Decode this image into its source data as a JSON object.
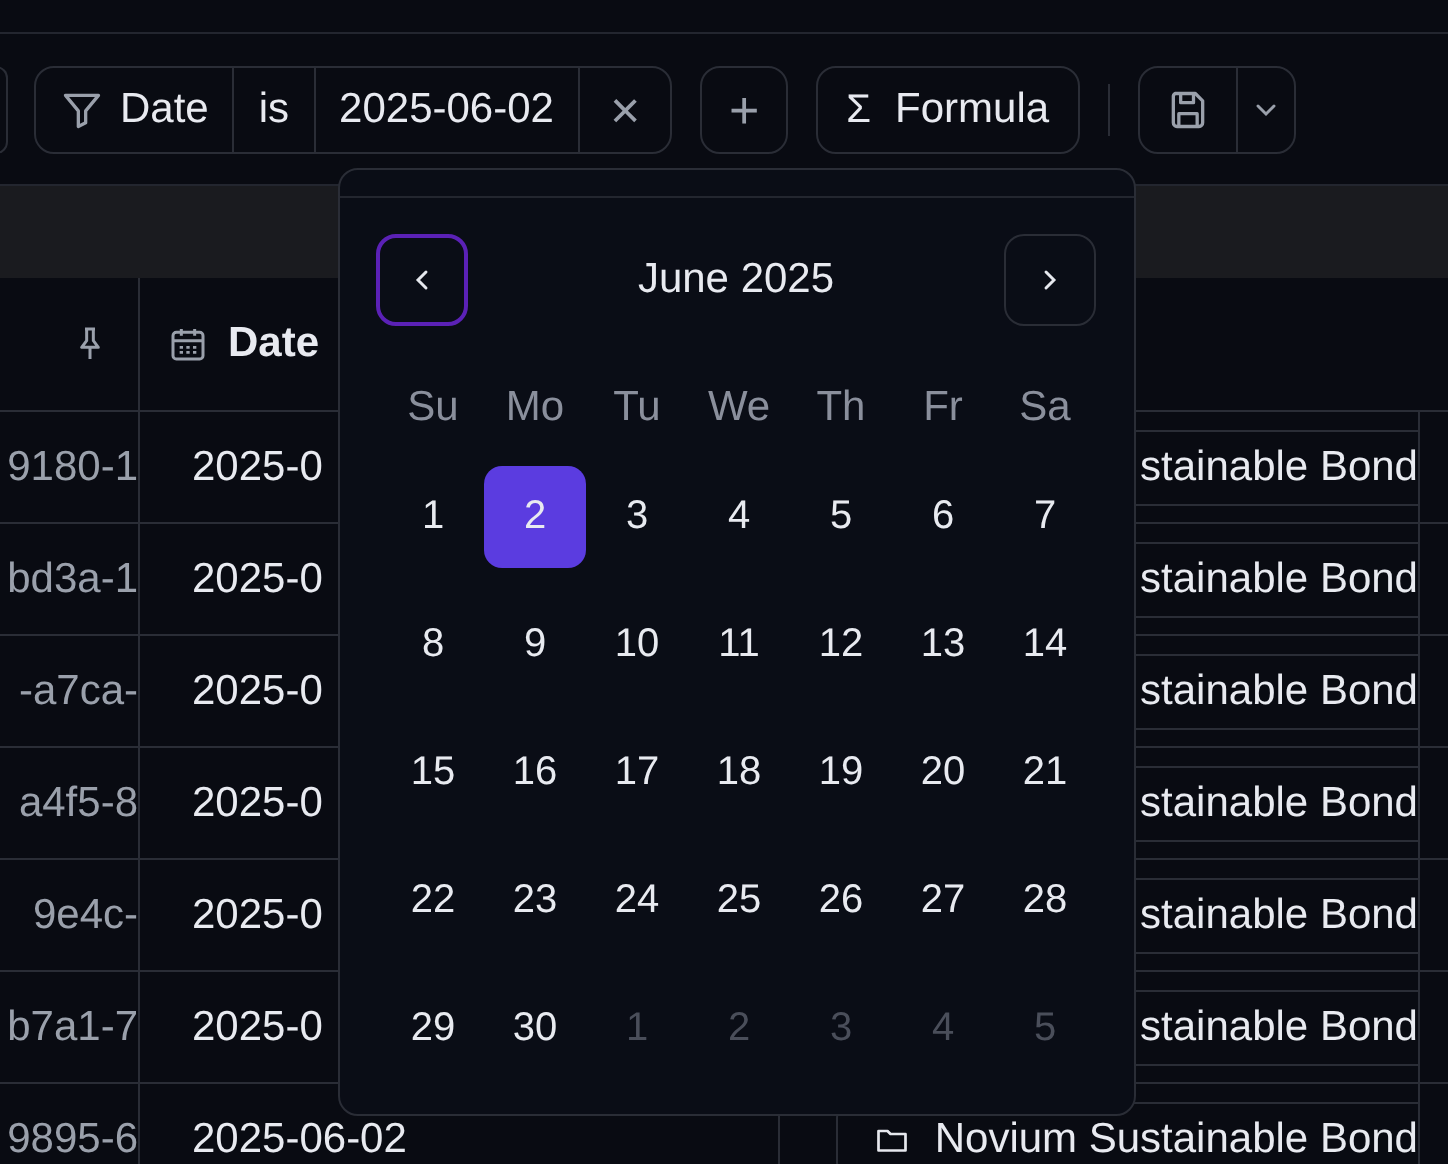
{
  "toolbar": {
    "filter": {
      "field": "Date",
      "operator": "is",
      "value": "2025-06-02",
      "clear": "×"
    },
    "add": "+",
    "formula": {
      "symbol": "Σ",
      "label": "Formula"
    }
  },
  "table": {
    "date_column": {
      "label": "Date"
    },
    "rows": [
      {
        "id": "9180-1",
        "date": "2025-0",
        "fund": "stainable Bond"
      },
      {
        "id": "bd3a-1",
        "date": "2025-0",
        "fund": "stainable Bond"
      },
      {
        "id": "-a7ca-",
        "date": "2025-0",
        "fund": "stainable Bond"
      },
      {
        "id": "a4f5-8",
        "date": "2025-0",
        "fund": "stainable Bond"
      },
      {
        "id": "9e4c-",
        "date": "2025-0",
        "fund": "stainable Bond"
      },
      {
        "id": "b7a1-7",
        "date": "2025-0",
        "fund": "stainable Bond"
      },
      {
        "id": "9895-6",
        "date": "2025-06-02",
        "fund": "Novium Sustainable Bond"
      }
    ]
  },
  "calendar": {
    "title": "June 2025",
    "weekdays": [
      "Su",
      "Mo",
      "Tu",
      "We",
      "Th",
      "Fr",
      "Sa"
    ],
    "weeks": [
      [
        {
          "day": "1",
          "in_month": true,
          "selected": false
        },
        {
          "day": "2",
          "in_month": true,
          "selected": true
        },
        {
          "day": "3",
          "in_month": true,
          "selected": false
        },
        {
          "day": "4",
          "in_month": true,
          "selected": false
        },
        {
          "day": "5",
          "in_month": true,
          "selected": false
        },
        {
          "day": "6",
          "in_month": true,
          "selected": false
        },
        {
          "day": "7",
          "in_month": true,
          "selected": false
        }
      ],
      [
        {
          "day": "8",
          "in_month": true,
          "selected": false
        },
        {
          "day": "9",
          "in_month": true,
          "selected": false
        },
        {
          "day": "10",
          "in_month": true,
          "selected": false
        },
        {
          "day": "11",
          "in_month": true,
          "selected": false
        },
        {
          "day": "12",
          "in_month": true,
          "selected": false
        },
        {
          "day": "13",
          "in_month": true,
          "selected": false
        },
        {
          "day": "14",
          "in_month": true,
          "selected": false
        }
      ],
      [
        {
          "day": "15",
          "in_month": true,
          "selected": false
        },
        {
          "day": "16",
          "in_month": true,
          "selected": false
        },
        {
          "day": "17",
          "in_month": true,
          "selected": false
        },
        {
          "day": "18",
          "in_month": true,
          "selected": false
        },
        {
          "day": "19",
          "in_month": true,
          "selected": false
        },
        {
          "day": "20",
          "in_month": true,
          "selected": false
        },
        {
          "day": "21",
          "in_month": true,
          "selected": false
        }
      ],
      [
        {
          "day": "22",
          "in_month": true,
          "selected": false
        },
        {
          "day": "23",
          "in_month": true,
          "selected": false
        },
        {
          "day": "24",
          "in_month": true,
          "selected": false
        },
        {
          "day": "25",
          "in_month": true,
          "selected": false
        },
        {
          "day": "26",
          "in_month": true,
          "selected": false
        },
        {
          "day": "27",
          "in_month": true,
          "selected": false
        },
        {
          "day": "28",
          "in_month": true,
          "selected": false
        }
      ],
      [
        {
          "day": "29",
          "in_month": true,
          "selected": false
        },
        {
          "day": "30",
          "in_month": true,
          "selected": false
        },
        {
          "day": "1",
          "in_month": false,
          "selected": false
        },
        {
          "day": "2",
          "in_month": false,
          "selected": false
        },
        {
          "day": "3",
          "in_month": false,
          "selected": false
        },
        {
          "day": "4",
          "in_month": false,
          "selected": false
        },
        {
          "day": "5",
          "in_month": false,
          "selected": false
        }
      ]
    ]
  }
}
